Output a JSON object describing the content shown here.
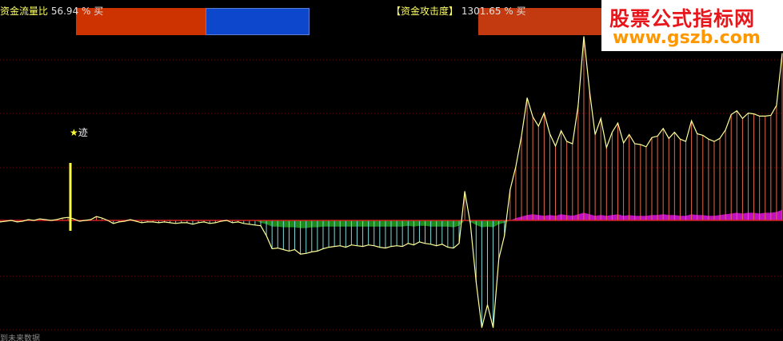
{
  "header_left": {
    "label": "资金流量比",
    "value": "56.94 % 买"
  },
  "header_right": {
    "label": "【资金攻击度】",
    "value": "1301.65 % 买"
  },
  "marker": {
    "star": "★",
    "text": "迹"
  },
  "watermark": {
    "title": "股票公式指标网",
    "url": "www.gszb.com"
  },
  "footnote": "到未来数据",
  "colors": {
    "background": "#000000",
    "flow_sell": "#cc3300",
    "flow_buy": "#0d47cc",
    "attack_bar": "#c43a10",
    "main_line": "#ffff99",
    "positive_hatch": "#e06a4a",
    "negative_hatch": "#7fd8d8",
    "zero_line": "#d02020",
    "green_fill": "#1c8a1c",
    "magenta_fill": "#c010c0",
    "marker": "#ffff44",
    "watermark_red": "#e8161b",
    "watermark_orange": "#ff9800"
  },
  "chart_data": {
    "type": "area",
    "title": "",
    "xlabel": "",
    "ylabel": "",
    "grid": true,
    "y_gridlines": 6,
    "main_series": [
      -2,
      -1,
      0,
      -2,
      -1,
      1,
      0,
      2,
      1,
      0,
      1,
      3,
      4,
      2,
      -1,
      0,
      1,
      5,
      3,
      0,
      -4,
      -2,
      -1,
      1,
      -1,
      -3,
      -2,
      -2,
      -3,
      -2,
      -3,
      -4,
      -3,
      -3,
      -5,
      -3,
      -2,
      -4,
      -3,
      -1,
      0,
      -3,
      -2,
      -4,
      -5,
      -6,
      -7,
      -20,
      -37,
      -36,
      -38,
      -40,
      -38,
      -44,
      -43,
      -41,
      -40,
      -37,
      -35,
      -34,
      -33,
      -35,
      -32,
      -33,
      -34,
      -32,
      -33,
      -35,
      -36,
      -34,
      -33,
      -34,
      -30,
      -32,
      -28,
      -30,
      -31,
      -33,
      -31,
      -35,
      -36,
      -30,
      38,
      -5,
      -80,
      -140,
      -110,
      -140,
      -50,
      -20,
      40,
      70,
      110,
      160,
      135,
      123,
      140,
      113,
      97,
      117,
      103,
      100,
      150,
      240,
      170,
      112,
      133,
      95,
      115,
      127,
      101,
      112,
      100,
      99,
      96,
      108,
      110,
      120,
      107,
      115,
      106,
      103,
      130,
      113,
      111,
      106,
      103,
      107,
      118,
      138,
      143,
      133,
      140,
      139,
      136,
      136,
      137,
      150,
      218
    ],
    "positive_fill_series": [
      0,
      0,
      0,
      0,
      0,
      0,
      0,
      0,
      0,
      0,
      0,
      0,
      0,
      0,
      0,
      0,
      0,
      0,
      0,
      0,
      0,
      0,
      0,
      0,
      0,
      0,
      0,
      0,
      0,
      0,
      0,
      0,
      0,
      0,
      0,
      0,
      0,
      0,
      0,
      0,
      0,
      0,
      0,
      0,
      0,
      0,
      0,
      0,
      0,
      0,
      0,
      0,
      0,
      0,
      0,
      0,
      0,
      0,
      0,
      0,
      0,
      0,
      0,
      0,
      0,
      0,
      0,
      0,
      0,
      0,
      0,
      0,
      0,
      0,
      0,
      0,
      0,
      0,
      0,
      0,
      0,
      0,
      0,
      0,
      0,
      0,
      0,
      0,
      0,
      0,
      0,
      3,
      5,
      7,
      8,
      7,
      6,
      7,
      6,
      8,
      7,
      6,
      8,
      10,
      8,
      6,
      7,
      6,
      7,
      8,
      6,
      7,
      6,
      6,
      6,
      7,
      7,
      8,
      7,
      7,
      6,
      6,
      8,
      7,
      7,
      6,
      6,
      7,
      8,
      9,
      10,
      9,
      10,
      10,
      9,
      10,
      10,
      11,
      14
    ],
    "negative_fill_series": [
      0,
      0,
      0,
      0,
      0,
      0,
      0,
      0,
      0,
      0,
      0,
      0,
      0,
      0,
      0,
      0,
      0,
      0,
      0,
      0,
      0,
      0,
      0,
      0,
      0,
      0,
      0,
      0,
      0,
      0,
      0,
      0,
      0,
      0,
      0,
      0,
      0,
      0,
      0,
      0,
      0,
      0,
      0,
      0,
      0,
      0,
      -3,
      -5,
      -8,
      -8,
      -9,
      -9,
      -9,
      -10,
      -10,
      -9,
      -9,
      -8,
      -8,
      -8,
      -8,
      -8,
      -8,
      -8,
      -8,
      -8,
      -8,
      -8,
      -8,
      -8,
      -8,
      -8,
      -7,
      -8,
      -7,
      -7,
      -8,
      -8,
      -8,
      -8,
      -9,
      -7,
      0,
      -2,
      -6,
      -9,
      -8,
      -9,
      -5,
      -3,
      0,
      0,
      0,
      0,
      0,
      0,
      0,
      0,
      0,
      0,
      0,
      0,
      0,
      0,
      0,
      0,
      0,
      0,
      0,
      0,
      0,
      0,
      0,
      0,
      0,
      0,
      0,
      0,
      0,
      0,
      0,
      0,
      0,
      0,
      0,
      0,
      0,
      0,
      0,
      0,
      0,
      0,
      0,
      0,
      0,
      0,
      0,
      0,
      0,
      0
    ],
    "marker_index": 18,
    "marker_value": 75,
    "ylim": [
      -150,
      250
    ]
  }
}
